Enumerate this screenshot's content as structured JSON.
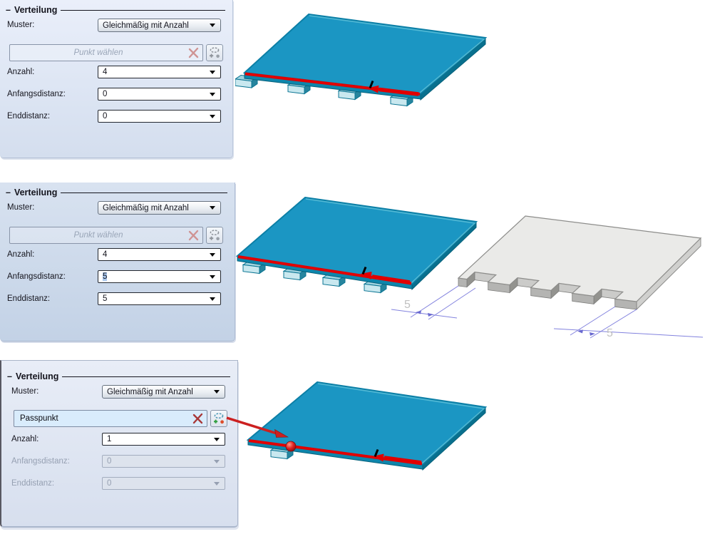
{
  "panels": [
    {
      "title": "Verteilung",
      "muster_label": "Muster:",
      "muster_value": "Gleichmäßig mit Anzahl",
      "point_placeholder": "Punkt wählen",
      "anzahl_label": "Anzahl:",
      "anzahl_value": "4",
      "anfang_label": "Anfangsdistanz:",
      "anfang_value": "0",
      "end_label": "Enddistanz:",
      "end_value": "0"
    },
    {
      "title": "Verteilung",
      "muster_label": "Muster:",
      "muster_value": "Gleichmäßig mit Anzahl",
      "point_placeholder": "Punkt wählen",
      "anzahl_label": "Anzahl:",
      "anzahl_value": "4",
      "anfang_label": "Anfangsdistanz:",
      "anfang_value": "5",
      "end_label": "Enddistanz:",
      "end_value": "5"
    },
    {
      "title": "Verteilung",
      "muster_label": "Muster:",
      "muster_value": "Gleichmäßig mit Anzahl",
      "point_value": "Passpunkt",
      "anzahl_label": "Anzahl:",
      "anzahl_value": "1",
      "anfang_label": "Anfangsdistanz:",
      "anfang_value": "0",
      "end_label": "Enddistanz:",
      "end_value": "0"
    }
  ],
  "scene": {
    "dim_left": "5",
    "dim_right": "5"
  },
  "icons": {
    "clear_point": "✕",
    "dropdown_arrow": "▼",
    "point_select": "point-cloud-with-add-marker"
  },
  "colors": {
    "plate_teal": "#1b96c3",
    "plate_side": "#0a7391",
    "tab_light": "#9fd3e0",
    "arrow_red": "#e10000",
    "gray_plate": "#eaeae8",
    "dimension_blue": "#8282de",
    "selection_blue": "#a9c8ef"
  }
}
